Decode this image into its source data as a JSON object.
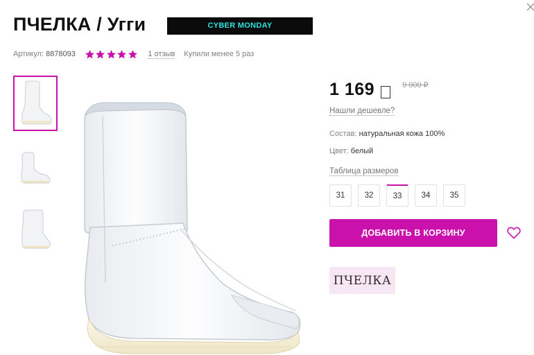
{
  "product": {
    "title": "ПЧЕЛКА / Угги",
    "promo_badge": "CYBER MONDAY",
    "article_label": "Артикул:",
    "article_value": "8878093",
    "rating": 5,
    "rating_max": 5,
    "reviews_link": "1 отзыв",
    "bought_text": "Купили менее 5 раз"
  },
  "gallery": {
    "thumbnails": [
      "boot-side-view",
      "boot-angle-view",
      "boot-back-view"
    ],
    "active_index": 0
  },
  "pricing": {
    "price": "1 169",
    "old_price": "9 000 ₽",
    "cheaper_link": "Нашли дешевле?"
  },
  "specs": {
    "composition_label": "Состав:",
    "composition_value": "натуральная кожа 100%",
    "color_label": "Цвет:",
    "color_value": "белый"
  },
  "sizes": {
    "table_link": "Таблица размеров",
    "options": [
      "31",
      "32",
      "33",
      "34",
      "35"
    ],
    "selected": "33"
  },
  "actions": {
    "add_to_cart": "ДОБАВИТЬ В КОРЗИНУ"
  },
  "brand": {
    "logo_text": "ПЧЕЛКА"
  },
  "colors": {
    "accent": "#cb11ab",
    "badge_bg": "#0b0b0b",
    "badge_text": "#2ee5e2",
    "brand_bg": "#f7e6f3"
  },
  "icons": [
    "close-icon",
    "star-icon",
    "currency-icon",
    "heart-icon"
  ]
}
